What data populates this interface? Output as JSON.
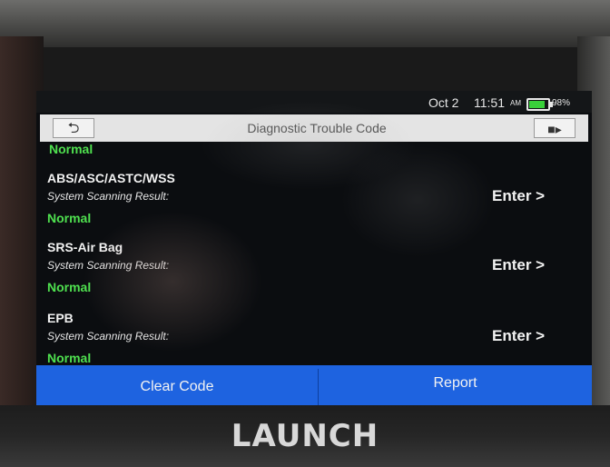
{
  "status_bar": {
    "date": "Oct 2",
    "time": "11:51",
    "ampm": "AM",
    "battery": "98%"
  },
  "title_bar": {
    "title": "Diagnostic Trouble Code",
    "back_icon": "back-arrow-icon",
    "exit_icon": "exit-door-icon"
  },
  "list": {
    "previous_status": "Normal",
    "systems": [
      {
        "name": "ABS/ASC/ASTC/WSS",
        "result_label": "System Scanning Result:",
        "status": "Normal",
        "action": "Enter >"
      },
      {
        "name": "SRS-Air Bag",
        "result_label": "System Scanning Result:",
        "status": "Normal",
        "action": "Enter >"
      },
      {
        "name": "EPB",
        "result_label": "System Scanning Result:",
        "status": "Normal",
        "action": "Enter >"
      }
    ]
  },
  "bottom_bar": {
    "clear_code": "Clear Code",
    "report": "Report"
  },
  "device": {
    "brand": "LAUNCH"
  },
  "colors": {
    "accent_blue": "#1e63e0",
    "status_green": "#4fe04f",
    "titlebar_bg": "#e4e4e4"
  }
}
